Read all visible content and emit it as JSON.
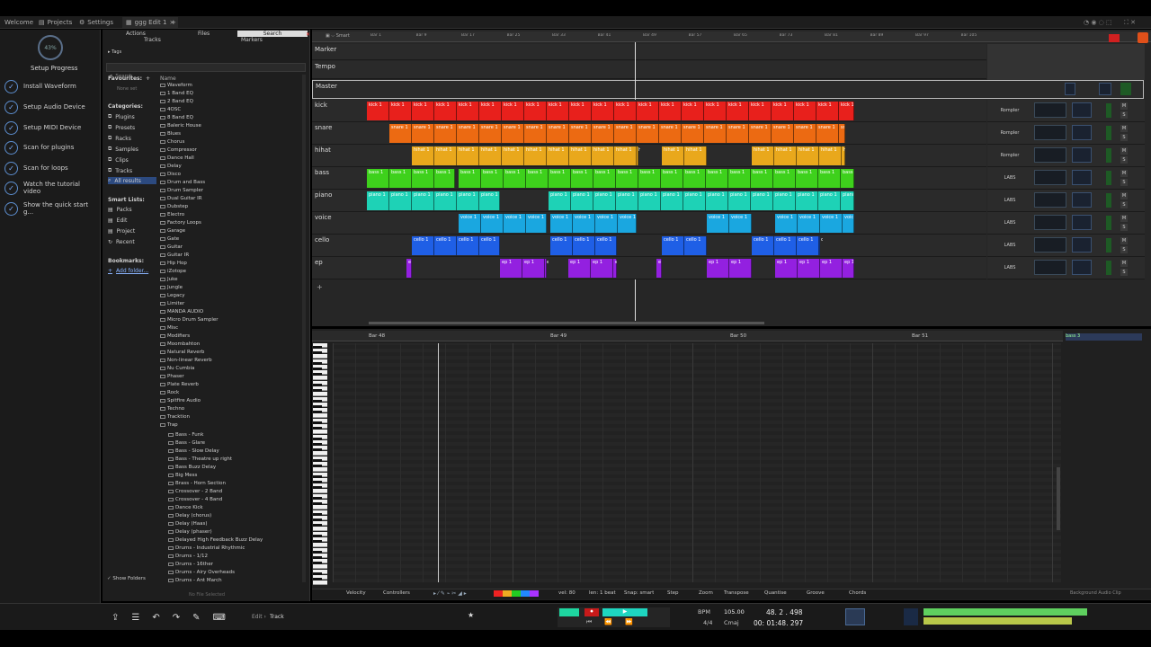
{
  "tabs": {
    "welcome": "Welcome",
    "projects": "Projects",
    "settings": "Settings",
    "edit": "ggg Edit 1"
  },
  "setup": {
    "progress": "43%",
    "title": "Setup Progress",
    "items": [
      "Install Waveform",
      "Setup Audio Device",
      "Setup MIDI Device",
      "Scan for plugins",
      "Scan for loops",
      "Watch the tutorial video",
      "Show the quick start g..."
    ]
  },
  "browser": {
    "tabs": [
      "Actions",
      "Files",
      "Search",
      "Tracks",
      "Markers"
    ],
    "tags": "Tags",
    "search_placeholder": "Search",
    "favourites": "Favourites:",
    "none_set": "None set",
    "name_col": "Name",
    "categories_label": "Categories:",
    "categories": [
      "Plugins",
      "Presets",
      "Racks",
      "Samples",
      "Clips",
      "Tracks",
      "All results"
    ],
    "smart_label": "Smart Lists:",
    "smart": [
      "Packs",
      "Edit",
      "Project",
      "Recent"
    ],
    "bookmarks_label": "Bookmarks:",
    "add_folder": "Add folder...",
    "folders": [
      "Waveform",
      "1 Band EQ",
      "2 Band EQ",
      "4OSC",
      "8 Band EQ",
      "Baleric House",
      "Blues",
      "Chorus",
      "Compressor",
      "Dance Hall",
      "Delay",
      "Disco",
      "Drum and Bass",
      "Drum Sampler",
      "Dual Guitar IR",
      "Dubstep",
      "Electro",
      "Factory Loops",
      "Garage",
      "Gate",
      "Guitar",
      "Guitar IR",
      "Hip Hop",
      "iZotope",
      "Juke",
      "Jungle",
      "Legacy",
      "Limiter",
      "MANDA AUDIO",
      "Micro Drum Sampler",
      "Misc",
      "Modifiers",
      "Moombahton",
      "Natural Reverb",
      "Non-linear Reverb",
      "Nu Cumbia",
      "Phaser",
      "Plate Reverb",
      "Rock",
      "Spitfire Audio",
      "Techno",
      "Tracktion",
      "Trap"
    ],
    "trap_items": [
      "Bass - Funk",
      "Bass - Glare",
      "Bass - Slow Delay",
      "Bass - Theatre up right",
      "Bass Buzz Delay",
      "Big Mess",
      "Brass - Horn Section",
      "Crossover - 2 Band",
      "Crossover - 4 Band",
      "Dance Kick",
      "Delay (chorus)",
      "Delay (Haas)",
      "Delay (phaser)",
      "Delayed High Feedback Buzz Delay",
      "Drums - Industrial Rhythmic",
      "Drums - 1/12",
      "Drums - 16ther",
      "Drums - Airy Overheads",
      "Drums - Ant March"
    ],
    "show_folders": "Show Folders",
    "no_file": "No File Selected"
  },
  "arrange": {
    "ruler": [
      "Bar 1",
      "Bar 9",
      "Bar 17",
      "Bar 25",
      "Bar 33",
      "Bar 41",
      "Bar 49",
      "Bar 57",
      "Bar 65",
      "Bar 73",
      "Bar 81",
      "Bar 89",
      "Bar 97",
      "Bar 105"
    ],
    "smart": "Smart",
    "marker": "Marker",
    "tempo": "Tempo",
    "master": "Master",
    "tracks": [
      {
        "name": "kick",
        "color": "#e8201c",
        "label": "kick 1",
        "plugin": "Rompler"
      },
      {
        "name": "snare",
        "color": "#ec6a12",
        "label": "snare 1",
        "plugin": "Rompler"
      },
      {
        "name": "hihat",
        "color": "#e9a81c",
        "label": "hihat 1",
        "plugin": "Rompler"
      },
      {
        "name": "bass",
        "color": "#3ed11c",
        "label": "bass 1",
        "plugin": "LABS"
      },
      {
        "name": "piano",
        "color": "#1ed2b6",
        "label": "piano 1",
        "plugin": "LABS"
      },
      {
        "name": "voice",
        "color": "#1aa7e0",
        "label": "voice 1",
        "plugin": "LABS"
      },
      {
        "name": "cello",
        "color": "#1f5fe6",
        "label": "cello 1",
        "plugin": "LABS"
      },
      {
        "name": "ep",
        "color": "#9320e0",
        "label": "ep 1",
        "plugin": "LABS"
      }
    ]
  },
  "editor": {
    "ruler": [
      "Bar 48",
      "Bar 49",
      "Bar 50",
      "Bar 51"
    ],
    "clip": "bass 3",
    "bottom": [
      "Velocity",
      "Controllers",
      "vel: 80",
      "len: 1 beat",
      "Snap: smart",
      "Step",
      "Zoom",
      "Transpose",
      "Quantise",
      "Groove",
      "Chords"
    ],
    "bg_clip": "Background Audio Clip"
  },
  "transport": {
    "edit": "Edit",
    "track": "Track",
    "bpm_label": "BPM",
    "bpm": "105.00",
    "sig": "4/4",
    "key": "Cmaj",
    "pos_bars": "48. 2 . 498",
    "pos_time": "00: 01:48. 297"
  }
}
